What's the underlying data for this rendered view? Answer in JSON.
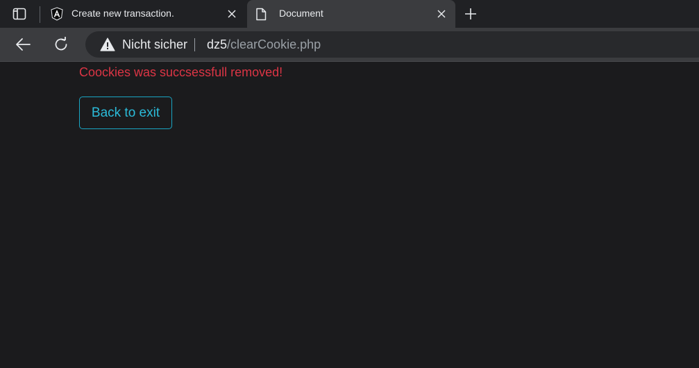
{
  "browser": {
    "tabs": [
      {
        "title": "Create new transaction.",
        "favicon": "angular-icon",
        "active": false
      },
      {
        "title": "Document",
        "favicon": "document-icon",
        "active": true
      }
    ],
    "address_bar": {
      "security_label": "Nicht sicher",
      "url_host": "dz5",
      "url_path": "/clearCookie.php"
    }
  },
  "page": {
    "message": "Coockies was succsessfull removed!",
    "back_button_label": "Back to exit"
  },
  "colors": {
    "message": "#dc3545",
    "button_accent": "#2bbbd9",
    "page_background": "#1b1b1d"
  }
}
